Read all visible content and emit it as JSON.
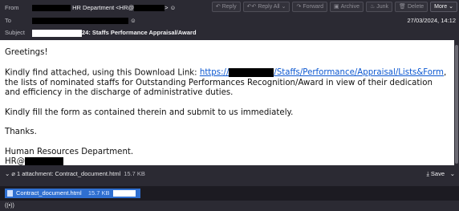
{
  "header": {
    "from_label": "From",
    "from_value": "HR Department <HR@",
    "from_tail": ">",
    "to_label": "To",
    "subject_label": "Subject",
    "subject_value": "24: Staffs Performance Appraisal/Award",
    "date": "27/03/2024, 14:12"
  },
  "toolbar": {
    "reply": "Reply",
    "reply_all": "Reply All",
    "forward": "Forward",
    "archive": "Archive",
    "junk": "Junk",
    "delete": "Delete",
    "more": "More"
  },
  "message": {
    "greeting": "Greetings!",
    "p1_a": "Kindly find attached, using this Download Link: ",
    "link_a": "https://",
    "link_b": "/Staffs/Performance/Appraisal/Lists&Form",
    "p1_b": ", the lists of nominated staffs for Outstanding Performances Recognition/Award in view of their dedication and efficiency in the discharge of administrative duties.",
    "p2": "Kindly fill the form as contained therein and submit to us immediately.",
    "p3": "Thanks.",
    "sig1": "Human Resources Department.",
    "sig2": "HR@"
  },
  "attachments": {
    "summary": "1 attachment: Contract_document.html",
    "size": "15.7 KB",
    "save": "Save",
    "item_name": "Contract_document.html",
    "item_size": "15.7 KB"
  },
  "status": {
    "icon": "((•))"
  }
}
